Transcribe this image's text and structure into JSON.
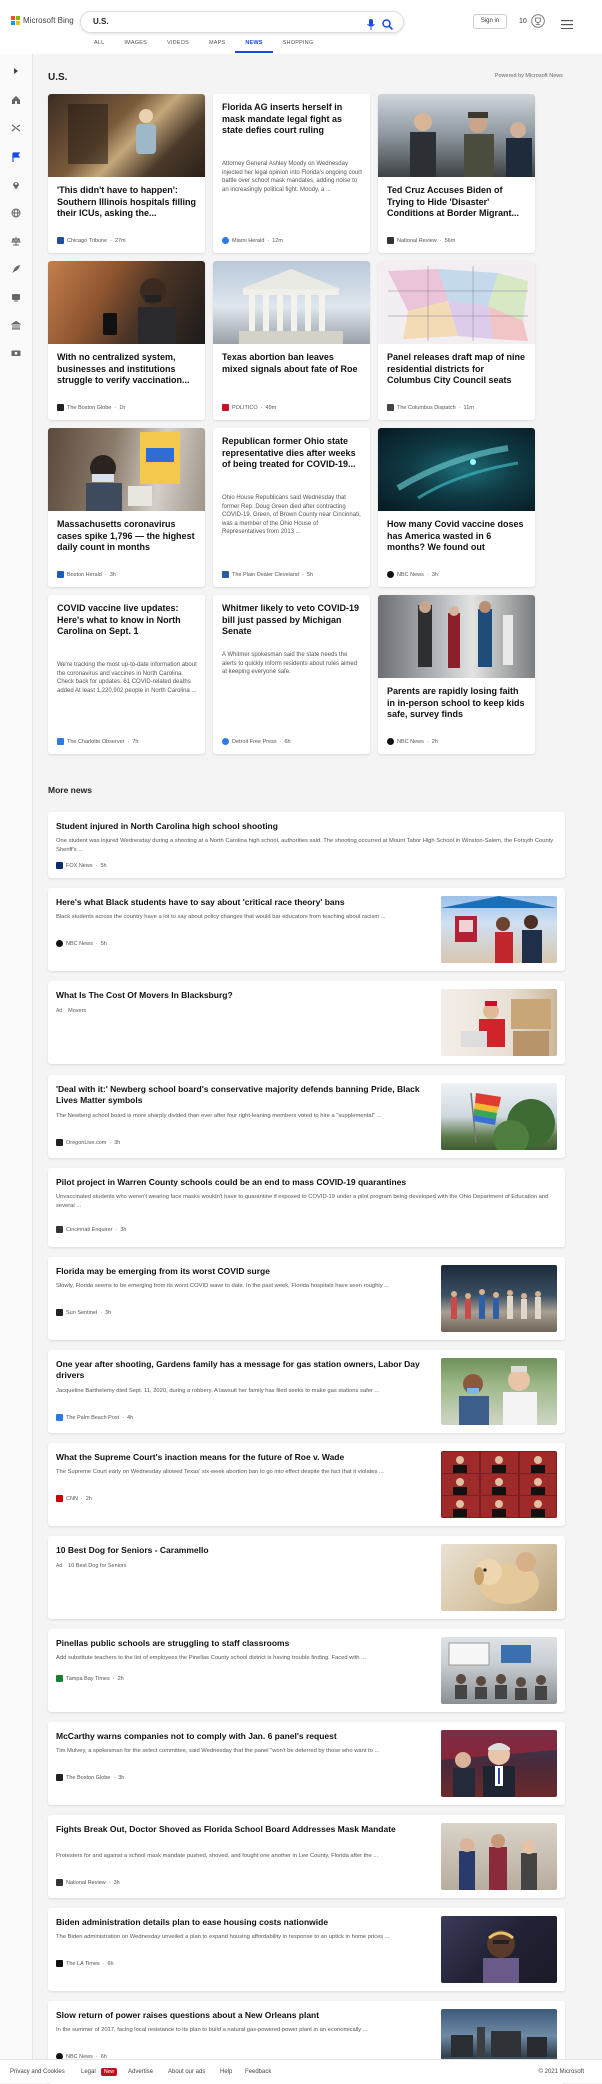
{
  "header": {
    "logo_text": "Microsoft Bing",
    "search_value": "U.S.",
    "signin_label": "Sign in",
    "rewards_count": "10"
  },
  "tabs": [
    "ALL",
    "IMAGES",
    "VIDEOS",
    "MAPS",
    "NEWS",
    "SHOPPING"
  ],
  "active_tab": "NEWS",
  "sidebar": {
    "icons": [
      "expand-icon",
      "home-icon",
      "shuffle-icon",
      "flag-icon",
      "location-pin-icon",
      "globe-icon",
      "scale-icon",
      "rocket-icon",
      "tv-icon",
      "building-icon",
      "money-icon"
    ]
  },
  "section": {
    "title": "U.S.",
    "powered": "Powered by Microsoft News"
  },
  "top_cards": [
    {
      "title": "'This didn't have to happen': Southern Illinois hospitals filling their ICUs, asking the...",
      "source": "Chicago Tribune",
      "time": "27m",
      "src_color": "#1f4e9c"
    },
    {
      "title": "Florida AG inserts herself in mask mandate legal fight as state defies court ruling",
      "snippet": "Attorney General Ashley Moody on Wednesday injected her legal opinion into Florida's ongoing court battle over school mask mandates, adding noise to an increasingly political fight. Moody, a ...",
      "source": "Miami Herald",
      "time": "12m",
      "src_color": "#2c7be5"
    },
    {
      "title": "Ted Cruz Accuses Biden of Trying to Hide 'Disaster' Conditions at Border Migrant...",
      "source": "National Review",
      "time": "56m",
      "src_color": "#333333"
    },
    {
      "title": "With no centralized system, businesses and institutions struggle to verify vaccination...",
      "source": "The Boston Globe",
      "time": "1h",
      "src_color": "#222222"
    },
    {
      "title": "Texas abortion ban leaves mixed signals about fate of Roe",
      "source": "POLITICO",
      "time": "49m",
      "src_color": "#c8102e"
    },
    {
      "title": "Panel releases draft map of nine residential districts for Columbus City Council seats",
      "source": "The Columbus Dispatch",
      "time": "11m",
      "src_color": "#444444"
    },
    {
      "title": "Massachusetts coronavirus cases spike 1,796 — the highest daily count in months",
      "source": "Boston Herald",
      "time": "3h",
      "src_color": "#1b5fb5"
    },
    {
      "title": "Republican former Ohio state representative dies after weeks of being treated for COVID-19...",
      "snippet": "Ohio House Republicans said Wednesday that former Rep. Doug Green died after contracting COVID-19. Green, of Brown County near Cincinnati, was a member of the Ohio House of Representatives from 2013 ...",
      "source": "The Plain Dealer Cleveland",
      "time": "5h",
      "src_color": "#2a5d9f"
    },
    {
      "title": "How many Covid vaccine doses has America wasted in 6 months? We found out",
      "source": "NBC News",
      "time": "3h",
      "src_color": "#111111"
    },
    {
      "title": "COVID vaccine live updates: Here's what to know in North Carolina on Sept. 1",
      "snippet": "We're tracking the most up-to-date information about the coronavirus and vaccines in North Carolina. Check back for updates. 61 COVID-related deaths added At least 1,220,902 people in North Carolina ...",
      "source": "The Charlotte Observer",
      "time": "7h",
      "src_color": "#2c7be5"
    },
    {
      "title": "Whitmer likely to veto COVID-19 bill just passed by Michigan Senate",
      "snippet": "A Whitmer spokesman said the state needs the alerts to quickly inform residents about rules aimed at keeping everyone safe.",
      "source": "Detroit Free Press",
      "time": "6h",
      "src_color": "#2c7be5"
    },
    {
      "title": "Parents are rapidly losing faith in in-person school to keep kids safe, survey finds",
      "source": "NBC News",
      "time": "2h",
      "src_color": "#111111"
    }
  ],
  "more_news": {
    "title": "More news",
    "items": [
      {
        "title": "Student injured in North Carolina high school shooting",
        "snippet": "One student was injured Wednesday during a shooting at a North Carolina high school, authorities said. The shooting occurred at Mount Tabor High School in Winston-Salem, the Forsyth County Sheriff's ...",
        "source": "FOX News",
        "time": "5h",
        "src_color": "#0a2d6e"
      },
      {
        "title": "Here's what Black students have to say about 'critical race theory' bans",
        "snippet": "Black students across the country have a lot to say about policy changes that would bar educators from teaching about racism ...",
        "source": "NBC News",
        "time": "5h",
        "src_color": "#111111"
      },
      {
        "title": "What Is The Cost Of Movers In Blacksburg?",
        "ad": "Ad",
        "source": "Movers",
        "src_color": ""
      },
      {
        "title": "'Deal with it:' Newberg school board's conservative majority defends banning Pride, Black Lives Matter symbols",
        "snippet": "The Newberg school board is more sharply divided than ever after four right-leaning members voted to hire a \"supplemental\" ...",
        "source": "OregonLive.com",
        "time": "3h",
        "src_color": "#222222"
      },
      {
        "title": "Pilot project in Warren County schools could be an end to mass COVID-19 quarantines",
        "snippet": "Unvaccinated students who weren't wearing face masks wouldn't have to quarantine if exposed to COVID-19 under a pilot program being developed with the Ohio Department of Education and several ...",
        "source": "Cincinnati Enquirer",
        "time": "3h",
        "src_color": "#333333"
      },
      {
        "title": "Florida may be emerging from its worst COVID surge",
        "snippet": "Slowly, Florida seems to be emerging from its worst COVID wave to date. In the past week, Florida hospitals have seen roughly ...",
        "source": "Sun Sentinel",
        "time": "3h",
        "src_color": "#222222"
      },
      {
        "title": "One year after shooting, Gardens family has a message for gas station owners, Labor Day drivers",
        "snippet": "Jacqueline Barthelemy died Sept. 11, 2020, during a robbery. A lawsuit her family has filed seeks to make gas stations safer ...",
        "source": "The Palm Beach Post",
        "time": "4h",
        "src_color": "#2c7be5"
      },
      {
        "title": "What the Supreme Court's inaction means for the future of Roe v. Wade",
        "snippet": "The Supreme Court early on Wednesday allowed Texas' six-week abortion ban to go into effect despite the fact that it violates ...",
        "source": "CNN",
        "time": "2h",
        "src_color": "#cc0000"
      },
      {
        "title": "10 Best Dog for Seniors - Carammello",
        "ad": "Ad",
        "source": "10 Best Dog for Seniors",
        "src_color": ""
      },
      {
        "title": "Pinellas public schools are struggling to staff classrooms",
        "snippet": "Add substitute teachers to the list of employees the Pinellas County school district is having trouble finding. Faced with ...",
        "source": "Tampa Bay Times",
        "time": "2h",
        "src_color": "#1b7f3a"
      },
      {
        "title": "McCarthy warns companies not to comply with Jan. 6 panel's request",
        "snippet": "Tim Mulvey, a spokesman for the select committee, said Wednesday that the panel \"won't be deterred by those who want to ...",
        "source": "The Boston Globe",
        "time": "3h",
        "src_color": "#222222"
      },
      {
        "title": "Fights Break Out, Doctor Shoved as Florida School Board Addresses Mask Mandate",
        "snippet": "Protesters for and against a school mask mandate pushed, shoved, and fought one another in Lee County, Florida after the ...",
        "source": "National Review",
        "time": "3h",
        "src_color": "#333333"
      },
      {
        "title": "Biden administration details plan to ease housing costs nationwide",
        "snippet": "The Biden administration on Wednesday unveiled a plan to expand housing affordability in response to an uptick in home prices ...",
        "source": "The LA Times",
        "time": "6h",
        "src_color": "#111111"
      },
      {
        "title": "Slow return of power raises questions about a New Orleans plant",
        "snippet": "In the summer of 2017, facing local resistance to its plan to build a natural gas-powered power plant in an economically ...",
        "source": "NBC News",
        "time": "6h",
        "src_color": "#111111"
      }
    ]
  },
  "footer": {
    "links": [
      "Privacy and Cookies",
      "Legal",
      "Advertise",
      "About our ads",
      "Help",
      "Feedback"
    ],
    "new_badge": "New",
    "copyright": "© 2021 Microsoft"
  }
}
